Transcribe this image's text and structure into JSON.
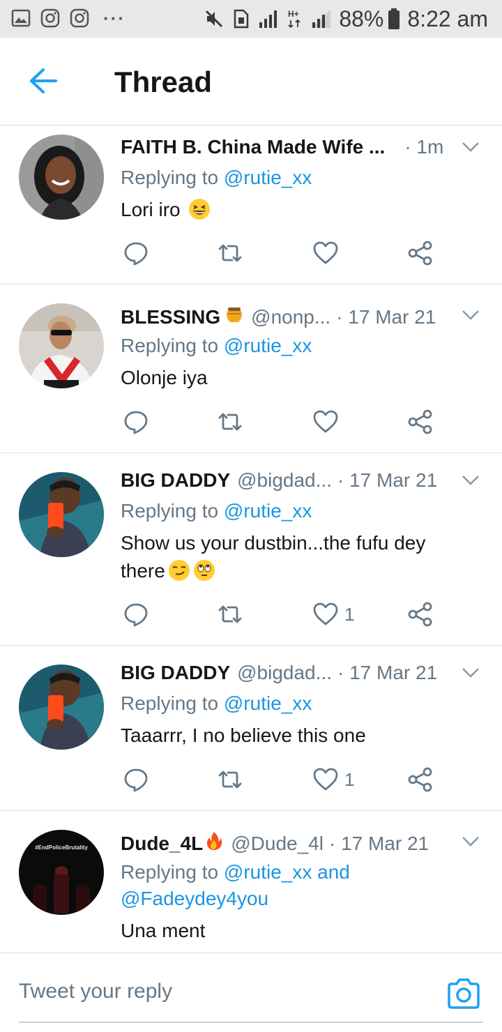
{
  "status_bar": {
    "left_icons": [
      "gallery-icon",
      "instagram-icon",
      "instagram-icon"
    ],
    "more": "···",
    "right_icons": [
      "mute-icon",
      "sim-icon",
      "signal-icon",
      "hplus-icon",
      "signal-icon",
      "battery-icon"
    ],
    "battery": "88%",
    "time": "8:22 am"
  },
  "header": {
    "back_icon": "arrow-left-icon",
    "title": "Thread"
  },
  "tweets": [
    {
      "name": "FAITH B. China Made Wife ...",
      "handle": "",
      "time": "· 1m",
      "replying_prefix": "Replying to ",
      "replying_to": "@rutie_xx",
      "replying_extra": "",
      "text": "Lori iro",
      "text_line2": "",
      "emojis": [
        "grinning-squint-emoji"
      ],
      "like_count": ""
    },
    {
      "name": "BLESSING",
      "name_emoji": "honey-pot-emoji",
      "handle": "@nonp...",
      "time": "· 17 Mar 21",
      "replying_prefix": "Replying to ",
      "replying_to": "@rutie_xx",
      "replying_extra": "",
      "text": "Olonje iya",
      "text_line2": "",
      "emojis": [],
      "like_count": ""
    },
    {
      "name": "BIG DADDY",
      "handle": "@bigdad...",
      "time": "· 17 Mar 21",
      "replying_prefix": "Replying to ",
      "replying_to": "@rutie_xx",
      "replying_extra": "",
      "text": "Show us your dustbin...the fufu dey",
      "text_line2": "there",
      "emojis": [
        "smirk-emoji",
        "eye-roll-emoji"
      ],
      "like_count": "1"
    },
    {
      "name": "BIG DADDY",
      "handle": "@bigdad...",
      "time": "· 17 Mar 21",
      "replying_prefix": "Replying to ",
      "replying_to": "@rutie_xx",
      "replying_extra": "",
      "text": "Taaarrr, I no believe this one",
      "text_line2": "",
      "emojis": [],
      "like_count": "1"
    },
    {
      "name": "Dude_4L",
      "name_emoji": "fire-emoji",
      "handle": "@Dude_4l",
      "time": "· 17 Mar 21",
      "replying_prefix": "Replying to ",
      "replying_to": "@rutie_xx and",
      "replying_extra": "@Fadeydey4you",
      "text": "Una ment",
      "text_line2": "",
      "emojis": [],
      "like_count": "",
      "avatar_text": "#EndPoliceBrutality"
    }
  ],
  "reply_bar": {
    "placeholder": "Tweet your reply",
    "camera_icon": "camera-icon"
  },
  "colors": {
    "accent": "#1da1f2",
    "mention": "#1b95e0",
    "secondary_text": "#657786",
    "divider": "#dee3e8"
  }
}
